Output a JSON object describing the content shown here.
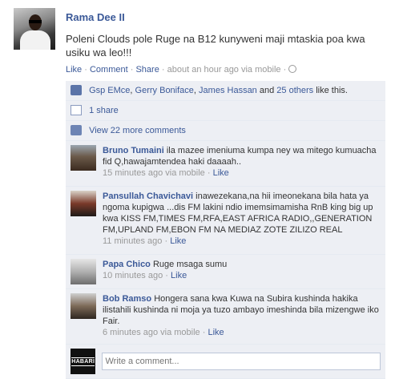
{
  "post": {
    "author": "Rama Dee II",
    "message": "Poleni Clouds pole Ruge na B12 kunyweni maji mtaskia poa kwa usiku wa leo!!!",
    "like_label": "Like",
    "comment_label": "Comment",
    "share_label": "Share",
    "timestamp": "about an hour ago via mobile"
  },
  "likes": {
    "names": [
      "Gsp EMce",
      "Gerry Boniface",
      "James Hassan"
    ],
    "and_text": "and",
    "others_label": "25 others",
    "suffix": "like this."
  },
  "shares_label": "1 share",
  "view_more_label": "View 22 more comments",
  "comments": [
    {
      "author": "Bruno Tumaini",
      "text": "ila mazee imeniuma kumpa ney wa mitego kumuacha fid Q,hawajamtendea haki daaaah..",
      "time": "15 minutes ago via mobile",
      "like": "Like"
    },
    {
      "author": "Pansullah Chavichavi",
      "text": "inawezekana,na hii imeonekana bila hata ya ngoma kupigwa ...dis FM lakini ndio imemsimamisha RnB king big up kwa KISS FM,TIMES FM,RFA,EAST AFRICA RADIO,,GENERATION FM,UPLAND FM,EBON FM NA MEDIAZ ZOTE ZILIZO REAL",
      "time": "11 minutes ago",
      "like": "Like"
    },
    {
      "author": "Papa Chico",
      "text": "Ruge msaga sumu",
      "time": "10 minutes ago",
      "like": "Like"
    },
    {
      "author": "Bob Ramso",
      "text": "Hongera sana kwa Kuwa na Subira kushinda hakika ilistahili kushinda ni moja ya tuzo ambayo imeshinda bila mizengwe iko Fair.",
      "time": "6 minutes ago via mobile",
      "like": "Like"
    }
  ],
  "compose": {
    "placeholder": "Write a comment...",
    "avatar_text": "HABARI"
  },
  "icons": {
    "like": "thumbs-up-icon",
    "share": "share-icon",
    "comments": "comment-bubble-icon",
    "privacy": "globe-icon"
  },
  "colors": {
    "link": "#3b5998",
    "ufi_bg": "#edeff4",
    "meta_gray": "#999999"
  }
}
